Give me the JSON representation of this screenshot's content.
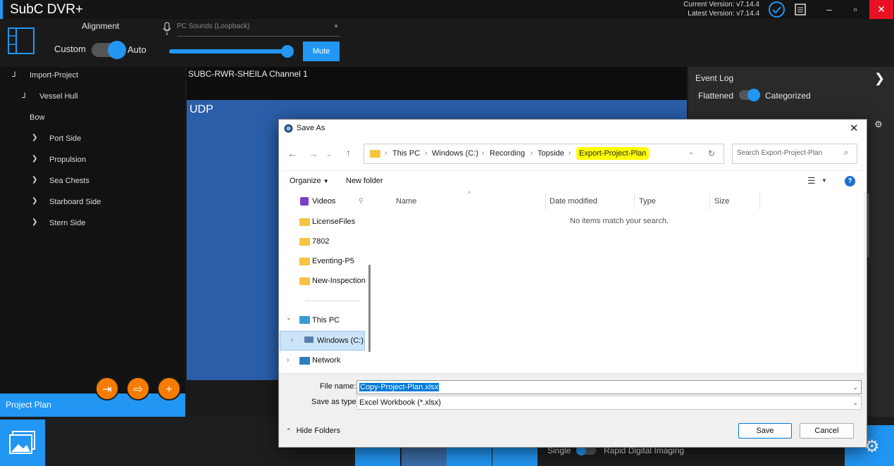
{
  "app": {
    "title": "SubC DVR+",
    "current_version": "Current Version: v7.14.4",
    "latest_version": "Latest Version: v7.14.4"
  },
  "controls": {
    "alignment_label": "Alignment",
    "custom_label": "Custom",
    "auto_label": "Auto",
    "audio_source": "PC Sounds (Loopback)",
    "volume": 1.0,
    "mute_label": "Mute"
  },
  "tree": {
    "root": "Import-Project",
    "level1": "Vessel Hull",
    "bow": "Bow",
    "items": [
      "Port Side",
      "Propulsion",
      "Sea Chests",
      "Starboard Side",
      "Stern Side"
    ]
  },
  "project_plan": {
    "label": "Project Plan"
  },
  "video": {
    "channel": "SUBC-RWR-SHEILA Channel 1",
    "overlay": "UDP"
  },
  "event_log": {
    "title": "Event Log",
    "flattened_label": "Flattened",
    "categorized_label": "Categorized"
  },
  "bottom": {
    "single_label": "Single",
    "rdi_label": "Rapid Digital Imaging"
  },
  "dialog": {
    "title": "Save As",
    "breadcrumbs": [
      "This PC",
      "Windows (C:)",
      "Recording",
      "Topside",
      "Export-Project-Plan"
    ],
    "search_placeholder": "Search Export-Project-Plan",
    "organize_label": "Organize",
    "new_folder_label": "New folder",
    "nav_items": [
      "Videos",
      "LicenseFiles",
      "7802",
      "Eventing-P5",
      "New-Inspection"
    ],
    "this_pc": "This PC",
    "windows_drive": "Windows (C:)",
    "network": "Network",
    "columns": [
      "Name",
      "Date modified",
      "Type",
      "Size"
    ],
    "empty_message": "No items match your search.",
    "file_name_label": "File name:",
    "file_name_value": "Copy-Project-Plan.xlsx",
    "save_as_type_label": "Save as type:",
    "save_as_type_value": "Excel Workbook (*.xlsx)",
    "hide_folders_label": "Hide Folders",
    "save_label": "Save",
    "cancel_label": "Cancel"
  }
}
